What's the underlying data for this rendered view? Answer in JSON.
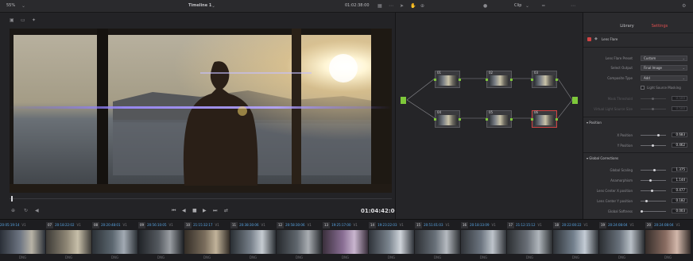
{
  "topbar": {
    "zoom": "55%",
    "timeline_name": "Timeline 1",
    "timecode": "01:02:38:00",
    "clip_mode": "Clip"
  },
  "viewer": {
    "timecode": "01:04:42:00"
  },
  "nodes": [
    {
      "label": "01"
    },
    {
      "label": "02"
    },
    {
      "label": "03"
    },
    {
      "label": "04"
    },
    {
      "label": "05"
    },
    {
      "label": "06"
    }
  ],
  "inspector": {
    "tabs": {
      "library": "Library",
      "settings": "Settings"
    },
    "effect_name": "Lens Flare",
    "dropdowns": [
      {
        "label": "Lens Flare Preset",
        "value": "Custom"
      },
      {
        "label": "Select Output",
        "value": "Final Image"
      },
      {
        "label": "Composite Type",
        "value": "Add"
      }
    ],
    "checkbox_label": "Light Source Masking",
    "dim_rows": [
      {
        "label": "Mask Threshold",
        "value": "0.500"
      },
      {
        "label": "Virtual Light Source Size",
        "value": "0.500"
      }
    ],
    "position_section": "Position",
    "position_rows": [
      {
        "label": "X Position",
        "value": "0.683"
      },
      {
        "label": "Y Position",
        "value": "0.462"
      }
    ],
    "global_section": "Global Corrections",
    "global_rows": [
      {
        "label": "Global Scaling",
        "value": "1.375"
      },
      {
        "label": "Anamorphism",
        "value": "1.144"
      },
      {
        "label": "Lens Center X position",
        "value": "0.477"
      },
      {
        "label": "Lens Center Y position",
        "value": "0.182"
      },
      {
        "label": "Global Softness",
        "value": "0.003"
      }
    ]
  },
  "clips": [
    {
      "num": "",
      "tc": "20:05:19:14",
      "track": "V1",
      "codec": "DNG"
    },
    {
      "num": "07",
      "tc": "20:18:22:02",
      "track": "V1",
      "codec": "DNG"
    },
    {
      "num": "08",
      "tc": "20:20:48:01",
      "track": "V1",
      "codec": "DNG"
    },
    {
      "num": "09",
      "tc": "20:56:10:05",
      "track": "V1",
      "codec": "DNG"
    },
    {
      "num": "10",
      "tc": "21:15:32:17",
      "track": "V1",
      "codec": "DNG"
    },
    {
      "num": "11",
      "tc": "20:38:30:06",
      "track": "V1",
      "codec": "DNG"
    },
    {
      "num": "12",
      "tc": "20:58:30:06",
      "track": "V1",
      "codec": "DNG"
    },
    {
      "num": "13",
      "tc": "19:25:17:00",
      "track": "V1",
      "codec": "DNG"
    },
    {
      "num": "14",
      "tc": "19:23:22:03",
      "track": "V1",
      "codec": "DNG"
    },
    {
      "num": "15",
      "tc": "20:51:01:03",
      "track": "V1",
      "codec": "DNG"
    },
    {
      "num": "16",
      "tc": "20:18:33:09",
      "track": "V1",
      "codec": "DNG"
    },
    {
      "num": "17",
      "tc": "21:12:15:12",
      "track": "V1",
      "codec": "DNG"
    },
    {
      "num": "18",
      "tc": "20:22:00:22",
      "track": "V1",
      "codec": "DNG"
    },
    {
      "num": "19",
      "tc": "20:24:08:04",
      "track": "V1",
      "codec": "DNG"
    },
    {
      "num": "20",
      "tc": "20:24:08:04",
      "track": "V1",
      "codec": "DNG"
    }
  ]
}
